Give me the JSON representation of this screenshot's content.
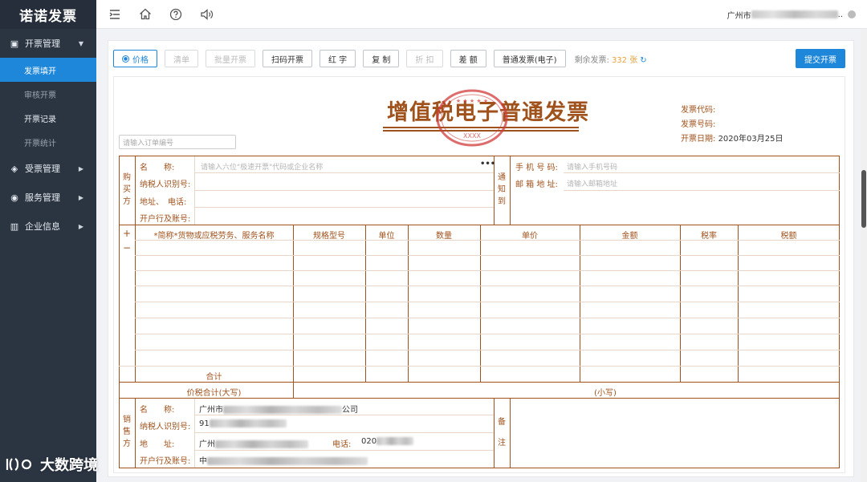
{
  "app": {
    "logo": "诺诺发票"
  },
  "sidebar": {
    "groups": [
      {
        "label": "开票管理",
        "icon": "invoice-icon",
        "arrow": "▼"
      },
      {
        "label": "受票管理",
        "icon": "layers-icon",
        "arrow": "▶"
      },
      {
        "label": "服务管理",
        "icon": "globe-icon",
        "arrow": "▶"
      },
      {
        "label": "企业信息",
        "icon": "building-icon",
        "arrow": "▶"
      }
    ],
    "subitems": [
      {
        "label": "发票填开",
        "active": true
      },
      {
        "label": "审核开票",
        "active": false
      },
      {
        "label": "开票记录",
        "active": false
      },
      {
        "label": "开票统计",
        "active": false
      }
    ]
  },
  "topbar": {
    "icons": [
      "menu-fold-icon",
      "home-icon",
      "help-icon",
      "speaker-icon"
    ],
    "user_prefix": "广州市",
    "user_suffix": ".."
  },
  "toolbar": {
    "price_label": "价格",
    "clear_label": "清单",
    "batch_label": "批量开票",
    "scan_label": "扫码开票",
    "red_label": "红 字",
    "copy_label": "复 制",
    "discount_label": "折 扣",
    "diff_label": "差 额",
    "type_label": "普通发票(电子)",
    "remain_label": "剩余发票:",
    "remain_count": "332 张",
    "refresh_icon": "↻",
    "submit_label": "提交开票"
  },
  "invoice": {
    "title": "增值税电子普通发票",
    "seal_text": "XXXX",
    "code_label": "发票代码:",
    "number_label": "发票号码:",
    "date_label": "开票日期:",
    "date_value": "2020年03月25日",
    "order_placeholder": "请输入订单编号",
    "buyer": {
      "side_label": [
        "购",
        "买",
        "方"
      ],
      "name_label": "名　　称:",
      "name_placeholder": "请输入六位\"极速开票\"代码或企业名称",
      "more": "•••",
      "taxid_label": "纳税人识别号:",
      "addr_label": "地址、　电话:",
      "bank_label": "开户行及账号:"
    },
    "notify": {
      "side_label": [
        "通",
        "知",
        "到"
      ],
      "phone_label": "手 机 号 码:",
      "phone_placeholder": "请输入手机号码",
      "email_label": "邮 箱 地 址:",
      "email_placeholder": "请输入邮箱地址"
    },
    "items": {
      "plus": "+",
      "minus": "−",
      "headers": [
        "*简称*货物或应税劳务、服务名称",
        "规格型号",
        "单位",
        "数量",
        "单价",
        "金额",
        "税率",
        "税额"
      ],
      "total_label": "合计",
      "total_in_words_label": "价税合计(大写)",
      "small_label": "(小写)"
    },
    "seller": {
      "side_label": [
        "销",
        "售",
        "方"
      ],
      "name_label": "名　　称:",
      "name_prefix": "广州市",
      "name_suffix": "公司",
      "taxid_label": "纳税人识别号:",
      "taxid_prefix": "91",
      "addr_label": "地　　址:",
      "addr_prefix": "广州",
      "phone_label": "电话:",
      "phone_prefix": "020",
      "bank_label": "开户行及账号:",
      "bank_prefix": "中"
    },
    "remark": {
      "side_label": [
        "备",
        "注"
      ]
    }
  },
  "watermark": {
    "text": "大数跨境"
  },
  "colors": {
    "accent": "#1e87d9",
    "invoice_brown": "#a0521c",
    "sidebar": "#2b3542",
    "seal_red": "#d23c3c"
  }
}
